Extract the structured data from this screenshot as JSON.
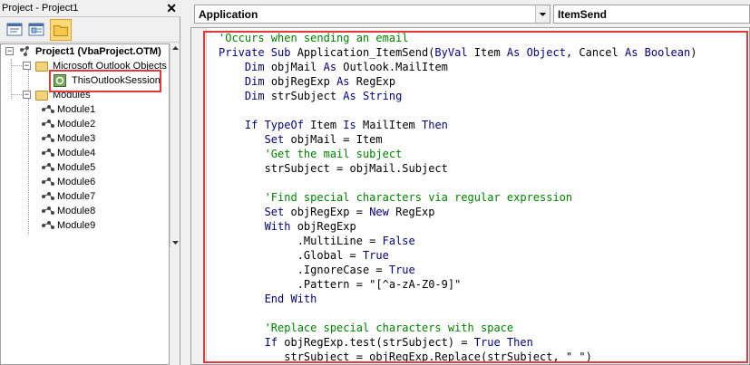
{
  "project_pane": {
    "title": "Project - Project1",
    "close_glyph": "✕",
    "toolbar": {
      "view_code_icon": "view-code-icon",
      "view_object_icon": "view-object-icon",
      "toggle_folders_icon": "folder-icon"
    },
    "tree": {
      "project_label": "Project1 (VbaProject.OTM)",
      "outlook_objects_label": "Microsoft Outlook Objects",
      "session_label": "ThisOutlookSession",
      "modules_label": "Modules",
      "modules": [
        "Module1",
        "Module2",
        "Module3",
        "Module4",
        "Module5",
        "Module6",
        "Module7",
        "Module8",
        "Module9"
      ],
      "expander_minus": "−"
    }
  },
  "code_window": {
    "object_combo": "Application",
    "procedure_combo": "ItemSend",
    "lines": [
      [
        {
          "t": "c",
          "s": "'Occurs when sending an email"
        }
      ],
      [
        {
          "t": "k",
          "s": "Private Sub "
        },
        {
          "t": "n",
          "s": "Application_ItemSend("
        },
        {
          "t": "k",
          "s": "ByVal "
        },
        {
          "t": "n",
          "s": "Item "
        },
        {
          "t": "k",
          "s": "As Object"
        },
        {
          "t": "n",
          "s": ", Cancel "
        },
        {
          "t": "k",
          "s": "As Boolean"
        },
        {
          "t": "n",
          "s": ")"
        }
      ],
      [
        {
          "t": "n",
          "s": "    "
        },
        {
          "t": "k",
          "s": "Dim "
        },
        {
          "t": "n",
          "s": "objMail "
        },
        {
          "t": "k",
          "s": "As "
        },
        {
          "t": "n",
          "s": "Outlook.MailItem"
        }
      ],
      [
        {
          "t": "n",
          "s": "    "
        },
        {
          "t": "k",
          "s": "Dim "
        },
        {
          "t": "n",
          "s": "objRegExp "
        },
        {
          "t": "k",
          "s": "As "
        },
        {
          "t": "n",
          "s": "RegExp"
        }
      ],
      [
        {
          "t": "n",
          "s": "    "
        },
        {
          "t": "k",
          "s": "Dim "
        },
        {
          "t": "n",
          "s": "strSubject "
        },
        {
          "t": "k",
          "s": "As String"
        }
      ],
      [
        {
          "t": "n",
          "s": ""
        }
      ],
      [
        {
          "t": "n",
          "s": "    "
        },
        {
          "t": "k",
          "s": "If TypeOf "
        },
        {
          "t": "n",
          "s": "Item "
        },
        {
          "t": "k",
          "s": "Is "
        },
        {
          "t": "n",
          "s": "MailItem "
        },
        {
          "t": "k",
          "s": "Then"
        }
      ],
      [
        {
          "t": "n",
          "s": "       "
        },
        {
          "t": "k",
          "s": "Set "
        },
        {
          "t": "n",
          "s": "objMail = Item"
        }
      ],
      [
        {
          "t": "n",
          "s": "       "
        },
        {
          "t": "c",
          "s": "'Get the mail subject"
        }
      ],
      [
        {
          "t": "n",
          "s": "       strSubject = objMail.Subject"
        }
      ],
      [
        {
          "t": "n",
          "s": ""
        }
      ],
      [
        {
          "t": "n",
          "s": "       "
        },
        {
          "t": "c",
          "s": "'Find special characters via regular expression"
        }
      ],
      [
        {
          "t": "n",
          "s": "       "
        },
        {
          "t": "k",
          "s": "Set "
        },
        {
          "t": "n",
          "s": "objRegExp = "
        },
        {
          "t": "k",
          "s": "New "
        },
        {
          "t": "n",
          "s": "RegExp"
        }
      ],
      [
        {
          "t": "n",
          "s": "       "
        },
        {
          "t": "k",
          "s": "With "
        },
        {
          "t": "n",
          "s": "objRegExp"
        }
      ],
      [
        {
          "t": "n",
          "s": "            .MultiLine = "
        },
        {
          "t": "k",
          "s": "False"
        }
      ],
      [
        {
          "t": "n",
          "s": "            .Global = "
        },
        {
          "t": "k",
          "s": "True"
        }
      ],
      [
        {
          "t": "n",
          "s": "            .IgnoreCase = "
        },
        {
          "t": "k",
          "s": "True"
        }
      ],
      [
        {
          "t": "n",
          "s": "            .Pattern = \"[^a-zA-Z0-9]\""
        }
      ],
      [
        {
          "t": "n",
          "s": "       "
        },
        {
          "t": "k",
          "s": "End With"
        }
      ],
      [
        {
          "t": "n",
          "s": ""
        }
      ],
      [
        {
          "t": "n",
          "s": "       "
        },
        {
          "t": "c",
          "s": "'Replace special characters with space"
        }
      ],
      [
        {
          "t": "n",
          "s": "       "
        },
        {
          "t": "k",
          "s": "If "
        },
        {
          "t": "n",
          "s": "objRegExp.test(strSubject) = "
        },
        {
          "t": "k",
          "s": "True Then"
        }
      ],
      [
        {
          "t": "n",
          "s": "          strSubject = objRegExp.Replace(strSubject, \" \")"
        }
      ]
    ]
  },
  "colors": {
    "highlight": "#e03a3a",
    "comment": "#008000",
    "keyword": "#00007f"
  }
}
